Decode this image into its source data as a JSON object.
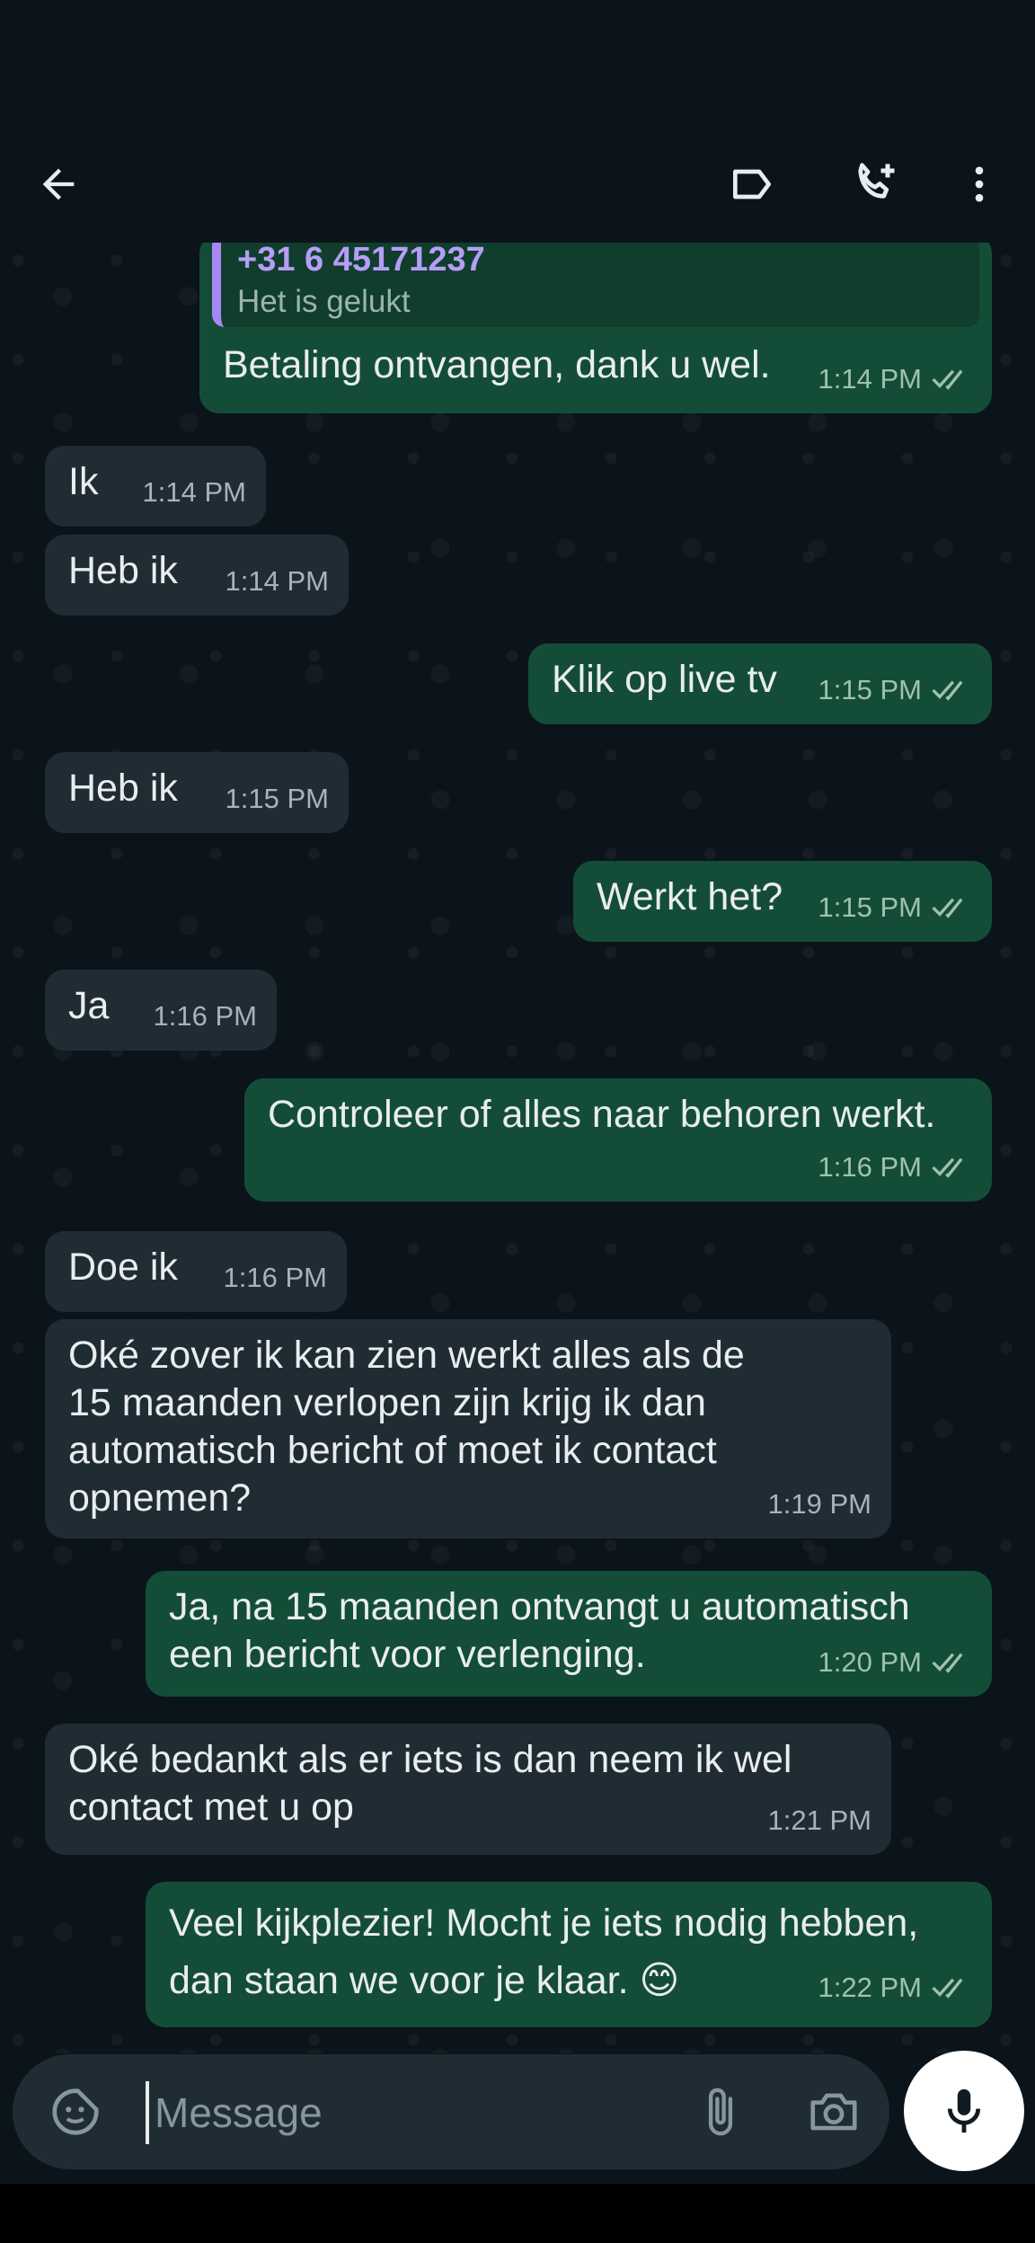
{
  "header": {
    "contact_name": "",
    "icons": [
      "back-arrow-icon",
      "label-icon",
      "add-call-icon",
      "more-vert-icon"
    ]
  },
  "messages": [
    {
      "dir": "out",
      "quote_phone": "+31 6 45171237",
      "quote_text": "Het is gelukt",
      "text": "Betaling ontvangen, dank u wel.",
      "time": "1:14 PM",
      "status": "read"
    },
    {
      "dir": "in",
      "text": "Ik",
      "time": "1:14 PM"
    },
    {
      "dir": "in",
      "text": "Heb ik",
      "time": "1:14 PM"
    },
    {
      "dir": "out",
      "text": "Klik op live tv",
      "time": "1:15 PM",
      "status": "read"
    },
    {
      "dir": "in",
      "text": "Heb ik",
      "time": "1:15 PM"
    },
    {
      "dir": "out",
      "text": "Werkt het?",
      "time": "1:15 PM",
      "status": "read"
    },
    {
      "dir": "in",
      "text": "Ja",
      "time": "1:16 PM"
    },
    {
      "dir": "out",
      "text": "Controleer of alles naar behoren werkt.",
      "time": "1:16 PM",
      "status": "read"
    },
    {
      "dir": "in",
      "text": "Doe ik",
      "time": "1:16 PM"
    },
    {
      "dir": "in",
      "text": "Oké zover ik kan zien werkt alles als de\n15 maanden verlopen zijn krijg ik dan\nautomatisch bericht of moet ik contact\nopnemen?",
      "time": "1:19 PM"
    },
    {
      "dir": "out",
      "text": "Ja, na 15 maanden ontvangt u automatisch\neen bericht voor verlenging.",
      "time": "1:20 PM",
      "status": "read"
    },
    {
      "dir": "in",
      "text": "Oké bedankt als er iets is dan neem ik wel\ncontact met u op",
      "time": "1:21 PM"
    },
    {
      "dir": "out",
      "text": "Veel kijkplezier! Mocht je iets nodig hebben,\ndan staan we voor je klaar. 😊",
      "time": "1:22 PM",
      "status": "read"
    }
  ],
  "composer": {
    "placeholder": "Message",
    "value": "",
    "icons": [
      "sticker-icon",
      "attach-icon",
      "camera-icon",
      "mic-icon"
    ]
  },
  "colors": {
    "background": "#0b141a",
    "incoming_bubble": "#202c33",
    "outgoing_bubble": "#144d37",
    "quote_accent": "#a688f5"
  }
}
